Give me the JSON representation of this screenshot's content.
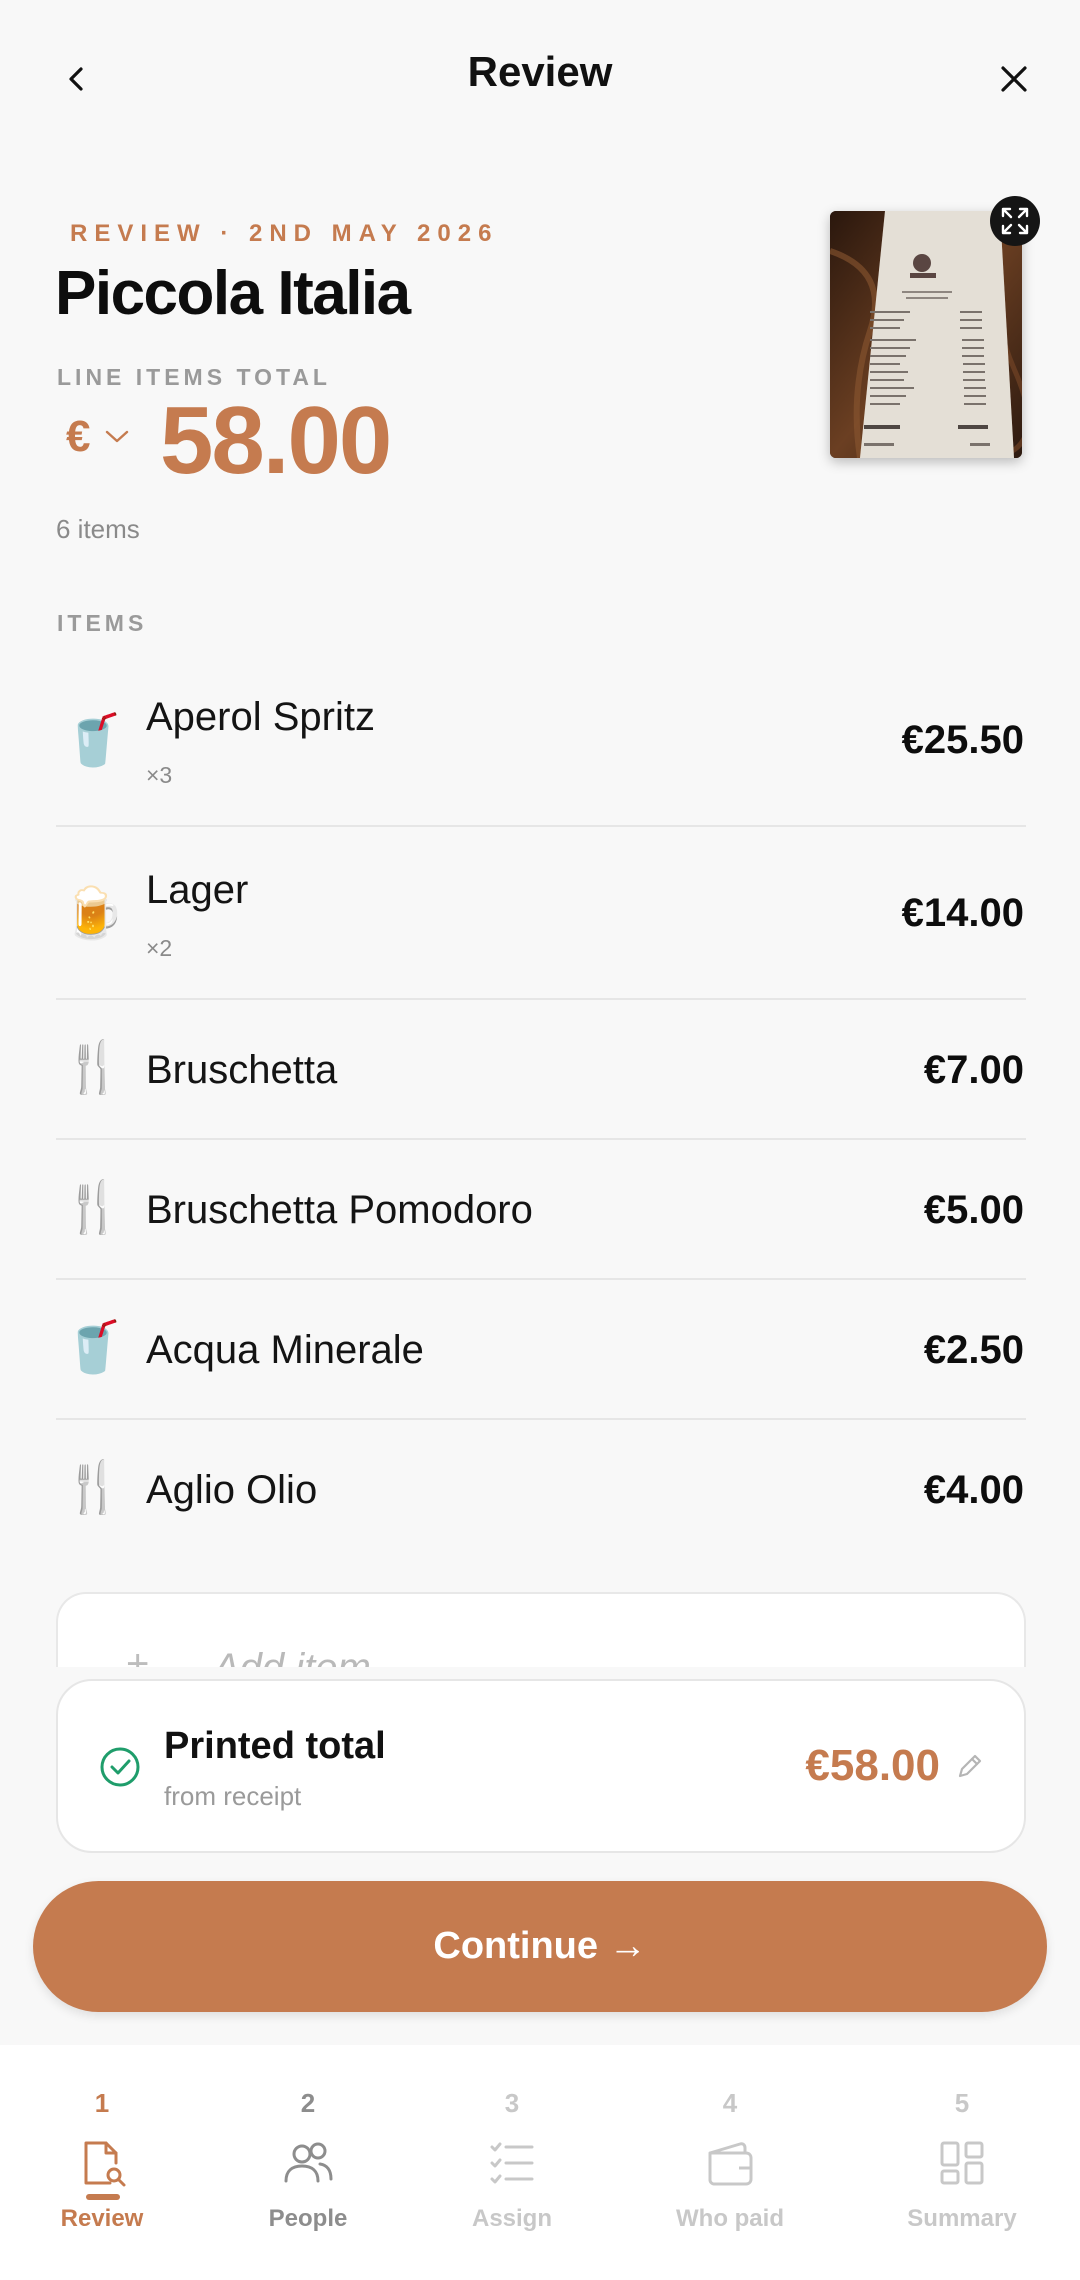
{
  "header": {
    "title": "Review"
  },
  "hero": {
    "eyebrow": "REVIEW · 2ND MAY 2026",
    "venue": "Piccola Italia",
    "total_label": "LINE ITEMS TOTAL",
    "currency_symbol": "€",
    "amount": "58.00",
    "item_count": "6 items"
  },
  "items_section": {
    "label": "ITEMS",
    "items": [
      {
        "icon": "🥤",
        "icon_name": "cup-with-straw-icon",
        "name": "Aperol Spritz",
        "qty": "×3",
        "price": "€25.50"
      },
      {
        "icon": "🍺",
        "icon_name": "beer-mug-icon",
        "name": "Lager",
        "qty": "×2",
        "price": "€14.00"
      },
      {
        "icon": "🍴",
        "icon_name": "fork-knife-icon",
        "name": "Bruschetta",
        "qty": "",
        "price": "€7.00"
      },
      {
        "icon": "🍴",
        "icon_name": "fork-knife-icon",
        "name": "Bruschetta Pomodoro",
        "qty": "",
        "price": "€5.00"
      },
      {
        "icon": "🥤",
        "icon_name": "cup-with-straw-icon",
        "name": "Acqua Minerale",
        "qty": "",
        "price": "€2.50"
      },
      {
        "icon": "🍴",
        "icon_name": "fork-knife-icon",
        "name": "Aglio Olio",
        "qty": "",
        "price": "€4.00"
      }
    ],
    "add_plus": "+",
    "add_placeholder": "Add item"
  },
  "printed_total": {
    "title": "Printed total",
    "subtitle": "from receipt",
    "amount": "€58.00"
  },
  "cta": {
    "label": "Continue →"
  },
  "bottom_nav": {
    "tabs": [
      {
        "num": "1",
        "label": "Review",
        "icon": "receipt-search-icon",
        "state": "active"
      },
      {
        "num": "2",
        "label": "People",
        "icon": "people-icon",
        "state": "enabled"
      },
      {
        "num": "3",
        "label": "Assign",
        "icon": "checklist-icon",
        "state": "disabled"
      },
      {
        "num": "4",
        "label": "Who paid",
        "icon": "wallet-icon",
        "state": "disabled"
      },
      {
        "num": "5",
        "label": "Summary",
        "icon": "grid-icon",
        "state": "disabled"
      }
    ]
  },
  "colors": {
    "accent": "#c57b4f",
    "background": "#f8f8f8",
    "check_green": "#1f9d6b"
  }
}
